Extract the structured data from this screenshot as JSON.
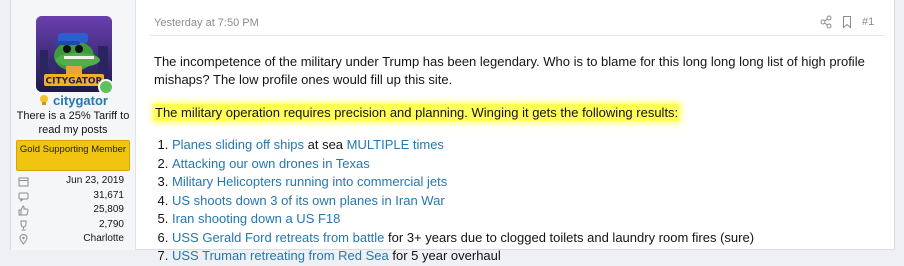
{
  "user": {
    "name": "citygator",
    "title": "There is a 25% Tariff to read my posts",
    "banner": "Gold Supporting Member",
    "stats": [
      {
        "icon": "calendar-icon",
        "value": "Jun 23, 2019"
      },
      {
        "icon": "messages-icon",
        "value": "31,671"
      },
      {
        "icon": "thumbs-up-icon",
        "value": "25,809"
      },
      {
        "icon": "trophy-icon",
        "value": "2,790"
      },
      {
        "icon": "location-pin-icon",
        "value": "Charlotte"
      }
    ]
  },
  "post": {
    "date": "Yesterday at 7:50 PM",
    "number": "#1",
    "paragraph1": "The incompetence of the military under Trump has been legendary. Who is to blame for this long long long list of high profile mishaps? The low profile ones would fill up this site.",
    "paragraph2": "The military operation requires precision and planning. Winging it gets the following results:",
    "items": [
      {
        "link": "Planes sliding off ships",
        "mid": " at sea ",
        "link2": "MULTIPLE times",
        "tail": ""
      },
      {
        "link": "Attacking our own drones in Texas",
        "tail": ""
      },
      {
        "link": "Military Helicopters running into commercial jets",
        "tail": ""
      },
      {
        "link": "US shoots down 3 of its own planes in Iran War",
        "tail": ""
      },
      {
        "link": "Iran shooting down a US F18",
        "tail": ""
      },
      {
        "link": "USS Gerald Ford retreats from battle",
        "tail": " for 3+ years due to clogged toilets and laundry room fires (sure)"
      },
      {
        "link": "USS Truman retreating from Red Sea",
        "tail": " for 5 year overhaul"
      }
    ]
  },
  "colors": {
    "link": "#2577b1",
    "highlight": "#ffff55",
    "banner": "#f1c40f",
    "online": "#5ec25c"
  }
}
